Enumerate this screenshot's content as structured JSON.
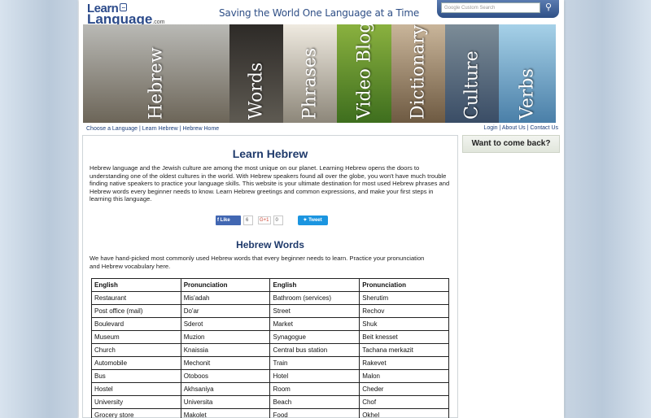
{
  "header": {
    "logo_line1": "Learn",
    "logo_bubble": "...",
    "logo_line2": "Language",
    "logo_domain": ".com",
    "tagline": "Saving the World One Language at a Time",
    "search_placeholder": "Google Custom Search"
  },
  "banner": {
    "panels": [
      {
        "label": "Hebrew",
        "color_top": "#b9b9b5",
        "color_bottom": "#6c6558"
      },
      {
        "label": "Words",
        "color_top": "#2d2a27",
        "color_bottom": "#5e5a52"
      },
      {
        "label": "Phrases",
        "color_top": "#efeae0",
        "color_bottom": "#8d877a"
      },
      {
        "label": "Video Blog",
        "color_top": "#8ab13f",
        "color_bottom": "#3e6e1e"
      },
      {
        "label": "Dictionary",
        "color_top": "#c9b59a",
        "color_bottom": "#6e5a42"
      },
      {
        "label": "Culture",
        "color_top": "#7c8c97",
        "color_bottom": "#3a4d66"
      },
      {
        "label": "Verbs",
        "color_top": "#a6d1e8",
        "color_bottom": "#4a7fa8"
      }
    ]
  },
  "nav": {
    "breadcrumb": "Choose a Language | Learn Hebrew | Hebrew Home",
    "toplinks": "Login | About Us | Contact Us"
  },
  "sidebar": {
    "box_label": "Want to come back?"
  },
  "main": {
    "title": "Learn Hebrew",
    "intro": "Hebrew language and the Jewish culture are among the most unique on our planet. Learning Hebrew opens the doors to understanding one of the oldest cultures in the world. With Hebrew speakers found all over the globe, you won't have much trouble finding native speakers to practice your language skills. This website is your ultimate destination for most used Hebrew phrases and Hebrew words every beginner needs to know. Learn Hebrew greetings and common expressions, and make your first steps in learning this language.",
    "social": {
      "like_label": "Like",
      "like_count": "6",
      "gplus_label": "G+1",
      "gplus_count": "0",
      "tweet_label": "Tweet"
    },
    "words_title": "Hebrew Words",
    "words_intro": "We have hand-picked most commonly used Hebrew words that every beginner needs to learn. Practice your pronunciation and Hebrew vocabulary here.",
    "table": {
      "headers": [
        "English",
        "Pronunciation",
        "English",
        "Pronunciation"
      ],
      "rows": [
        [
          "Restaurant",
          "Mis'adah",
          "Bathroom (services)",
          "Sherutim"
        ],
        [
          "Post office (mail)",
          "Do'ar",
          "Street",
          "Rechov"
        ],
        [
          "Boulevard",
          "Sderot",
          "Market",
          "Shuk"
        ],
        [
          "Museum",
          "Muzion",
          "Synagogue",
          "Beit knesset"
        ],
        [
          "Church",
          "Knaissia",
          "Central bus station",
          "Tachana merkazit"
        ],
        [
          "Automobile",
          "Mechonit",
          "Train",
          "Rakevet"
        ],
        [
          "Bus",
          "Otoboos",
          "Hotel",
          "Malon"
        ],
        [
          "Hostel",
          "Akhsaniya",
          "Room",
          "Cheder"
        ],
        [
          "University",
          "Universita",
          "Beach",
          "Chof"
        ],
        [
          "Grocery store",
          "Makolet",
          "Food",
          "Okhel"
        ]
      ]
    }
  }
}
